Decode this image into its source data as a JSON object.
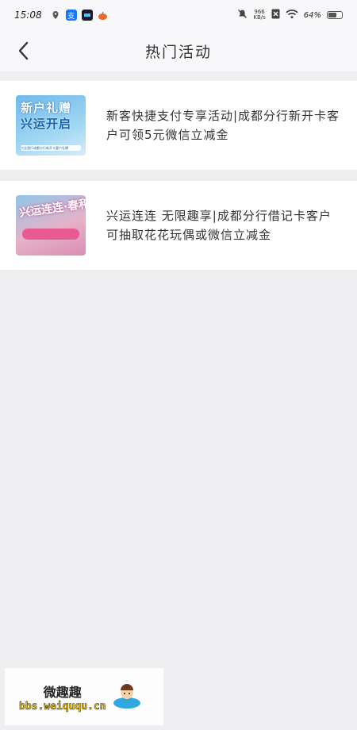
{
  "status_bar": {
    "time": "15:08",
    "app_icons": [
      "location-icon",
      "alipay-icon",
      "app-icon",
      "pumpkin-icon"
    ],
    "net_speed_value": "966",
    "net_speed_unit": "KB/s",
    "battery_percent": "64%",
    "battery_level": 0.64
  },
  "header": {
    "title": "热门活动"
  },
  "activities": [
    {
      "title": "新客快捷支付专享活动|成都分行新开卡客户可领5元微信立减金",
      "thumb_line1": "新户礼赠",
      "thumb_line2": "兴运开启",
      "thumb_caption": "兴业银行成都分行新开卡客户礼赠"
    },
    {
      "title": "兴运连连 无限趣享|成都分行借记卡客户可抽取花花玩偶或微信立减金",
      "thumb_line1": "兴运连连·春和景明"
    }
  ],
  "watermark": {
    "name": "微趣趣",
    "url": "bbs.weiququ.cn"
  },
  "colors": {
    "background": "#efeff1",
    "header_bg": "#f8f8fa",
    "card_bg": "#ffffff",
    "text": "#333333"
  }
}
